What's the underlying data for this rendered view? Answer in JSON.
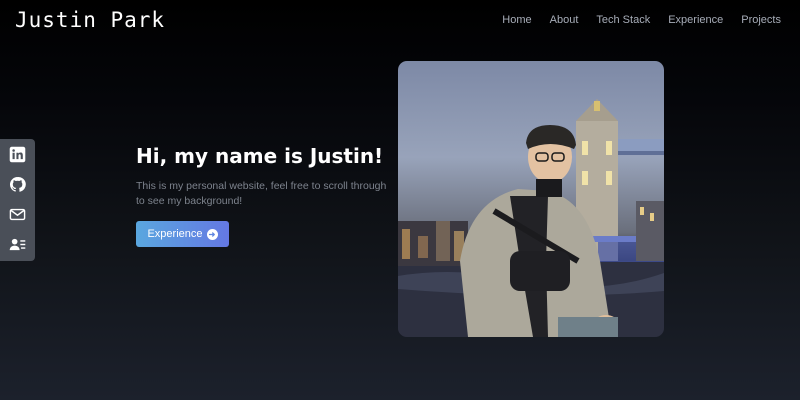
{
  "brand": {
    "name": "Justin Park"
  },
  "nav": {
    "items": [
      {
        "label": "Home"
      },
      {
        "label": "About"
      },
      {
        "label": "Tech Stack"
      },
      {
        "label": "Experience"
      },
      {
        "label": "Projects"
      }
    ]
  },
  "social": {
    "icons": [
      "linkedin-icon",
      "github-icon",
      "mail-icon",
      "contact-card-icon"
    ]
  },
  "hero": {
    "title": "Hi, my name is Justin!",
    "subtitle": "This is my personal website, feel free to scroll through to see my background!",
    "cta_label": "Experience"
  },
  "colors": {
    "accent_start": "#5aa7df",
    "accent_end": "#6478e3",
    "sidebar_bg": "#4a4f58",
    "nav_text": "#a7adb8",
    "subtitle_text": "#7d838d"
  }
}
